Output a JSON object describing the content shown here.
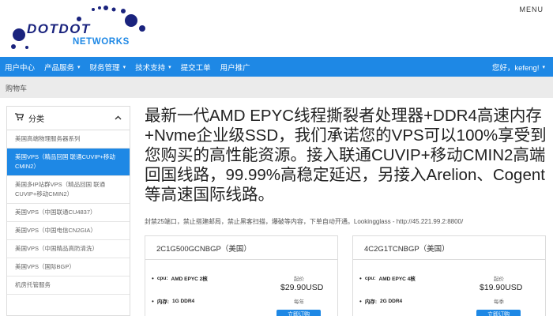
{
  "header": {
    "logo_text_line1": "DOTDOT",
    "logo_text_line2": "NETWORKS",
    "menu_label": "MENU"
  },
  "navbar": {
    "items": [
      {
        "label": "用户中心",
        "caret": false
      },
      {
        "label": "产品服务",
        "caret": true
      },
      {
        "label": "财务管理",
        "caret": true
      },
      {
        "label": "技术支持",
        "caret": true
      },
      {
        "label": "提交工单",
        "caret": false
      },
      {
        "label": "用户推广",
        "caret": false
      }
    ],
    "user_greeting": "您好，kefeng!",
    "caret_glyph": "▾"
  },
  "breadcrumb": {
    "current": "购物车"
  },
  "sidebar": {
    "title": "分类",
    "items": [
      "美国高端物理服务器系列",
      "美国VPS（精品回国 联通CUVIP+移动CMIN2）",
      "美国多IP站群VPS（精品回国 联通CUVIP+移动CMIN2）",
      "美国VPS（中国联通CU4837）",
      "美国VPS（中国电信CN2GIA）",
      "美国VPS（中国精品高防清洗）",
      "美国VPS（国际BGP）",
      "机房托管服务"
    ],
    "active_index": 1
  },
  "main": {
    "headline": "最新一代AMD EPYC线程撕裂者处理器+DDR4高速内存+Nvme企业级SSD，我们承诺您的VPS可以100%享受到您购买的高性能资源。接入联通CUVIP+移动CMIN2高端回国线路，99.99%高稳定延迟，另接入Arelion、Cogent等高速国际线路。",
    "notice": "封禁25端口，禁止搭建邮局，禁止黑客扫描，爆破等内容，下单自动开通。Lookingglass - http://45.221.99.2:8800/"
  },
  "products": [
    {
      "title": "2C1G500GCNBGP（美国）",
      "cpu_label": "cpu:",
      "cpu_value": "AMD EPYC 2核",
      "ram_label": "内存:",
      "ram_value": "1G DDR4",
      "price_from": "起价",
      "price": "$29.90USD",
      "cycle": "每年",
      "order_label": "立即订购"
    },
    {
      "title": "4C2G1TCNBGP（美国）",
      "cpu_label": "cpu:",
      "cpu_value": "AMD EPYC 4核",
      "ram_label": "内存:",
      "ram_value": "2G DDR4",
      "price_from": "起价",
      "price": "$19.90USD",
      "cycle": "每季",
      "order_label": "立即订购"
    }
  ],
  "colors": {
    "brand_blue": "#1e88e5",
    "logo_navy": "#1a237e"
  },
  "icons": [
    "cart-icon",
    "chevron-up-icon",
    "caret-down-icon",
    "bullet-icon"
  ]
}
